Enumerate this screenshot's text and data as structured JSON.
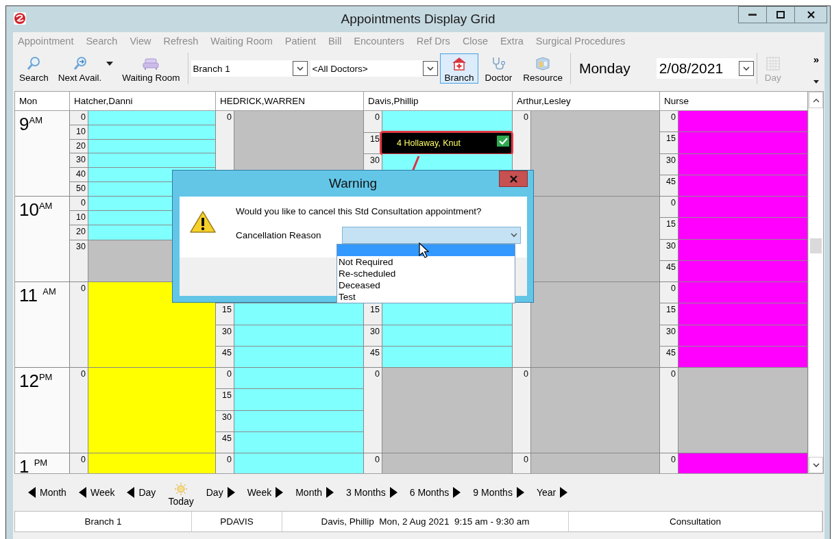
{
  "window": {
    "title": "Appointments Display Grid"
  },
  "menu": [
    {
      "label": "Appointment",
      "disabled": true
    },
    {
      "label": "Search",
      "disabled": true
    },
    {
      "label": "View",
      "disabled": true
    },
    {
      "label": "Refresh",
      "disabled": true
    },
    {
      "label": "Waiting Room",
      "disabled": true
    },
    {
      "label": "Patient",
      "disabled": true
    },
    {
      "label": "Bill",
      "disabled": true
    },
    {
      "label": "Encounters",
      "disabled": true
    },
    {
      "label": "Ref Drs",
      "disabled": true
    },
    {
      "label": "Close",
      "disabled": true
    },
    {
      "label": "Extra",
      "disabled": true
    },
    {
      "label": "Surgical Procedures",
      "disabled": true
    }
  ],
  "toolbar": {
    "tools": [
      {
        "label": "Search",
        "kind": "search"
      },
      {
        "label": "Next Avail.",
        "kind": "next",
        "has_menu": true
      },
      {
        "label": "Waiting Room",
        "kind": "sofa"
      }
    ],
    "branch_combo": "Branch 1",
    "doctor_combo": "<All Doctors>",
    "views": [
      {
        "label": "Branch",
        "kind": "branch",
        "selected": true
      },
      {
        "label": "Doctor",
        "kind": "doctor",
        "selected": false
      },
      {
        "label": "Resource",
        "kind": "resource",
        "selected": false
      }
    ],
    "weekday": "Monday",
    "date": "2/08/2021",
    "day_button": {
      "label": "Day",
      "disabled": true
    },
    "overflow": "»"
  },
  "grid": {
    "columns": [
      "Mon",
      "Hatcher,Danni",
      "HEDRICK,WARREN",
      "Davis,Phillip",
      "Arthur,Lesley",
      "Nurse"
    ],
    "hours": [
      {
        "time": "9$^{AM}$",
        "cells": [
          {
            "slots": [
              {
                "minute": "0",
                "color": "#80ffff"
              },
              {
                "minute": "10",
                "color": "#80ffff"
              },
              {
                "minute": "20",
                "color": "#80ffff"
              },
              {
                "minute": "30",
                "color": "#80ffff"
              },
              {
                "minute": "40",
                "color": "#80ffff"
              },
              {
                "minute": "50",
                "color": "#80ffff"
              }
            ]
          },
          {
            "slots": [
              {
                "minute": "0",
                "color": "#c0c0c0"
              }
            ]
          },
          {
            "slots": [
              {
                "minute": "0",
                "color": "#80ffff"
              },
              {
                "minute": "15",
                "appointment": {
                  "patient": "4 Hollaway, Knut",
                  "confirmed": true
                }
              },
              {
                "minute": "30",
                "color": "#80ffff"
              }
            ]
          },
          {
            "slots": [
              {
                "minute": "0",
                "color": "#c0c0c0"
              }
            ]
          },
          {
            "slots": [
              {
                "minute": "0",
                "color": "#ff00ff"
              },
              {
                "minute": "15",
                "color": "#ff00ff"
              },
              {
                "minute": "30",
                "color": "#ff00ff"
              },
              {
                "minute": "45",
                "color": "#ff00ff"
              }
            ]
          }
        ]
      },
      {
        "time": "10$^{AM}$",
        "cells": [
          {
            "slots": [
              {
                "minute": "0",
                "color": "#80ffff"
              },
              {
                "minute": "10",
                "color": "#80ffff"
              },
              {
                "minute": "20",
                "color": "#80ffff"
              },
              {
                "minute": "30",
                "color": "#c0c0c0"
              }
            ]
          },
          {},
          {},
          {
            "slots": [
              {
                "color": "#c0c0c0"
              }
            ]
          },
          {
            "slots": [
              {
                "minute": "0",
                "color": "#ff00ff"
              },
              {
                "minute": "15",
                "color": "#ff00ff"
              },
              {
                "minute": "30",
                "color": "#ff00ff"
              },
              {
                "minute": "45",
                "color": "#ff00ff"
              }
            ]
          }
        ]
      },
      {
        "time": "11 $^{AM}$",
        "cells": [
          {
            "slots": [
              {
                "minute": "0",
                "color": "#ffff00"
              }
            ]
          },
          {
            "slots": [
              {
                "minute": "15",
                "color": "#80ffff"
              },
              {
                "minute": "30",
                "color": "#80ffff"
              },
              {
                "minute": "45",
                "color": "#80ffff"
              }
            ]
          },
          {
            "slots": [
              {
                "minute": "15",
                "color": "#80ffff"
              },
              {
                "minute": "30",
                "color": "#80ffff"
              },
              {
                "minute": "45",
                "color": "#80ffff"
              }
            ]
          },
          {
            "slots": [
              {
                "color": "#c0c0c0"
              }
            ]
          },
          {
            "slots": [
              {
                "minute": "0",
                "color": "#ff00ff"
              },
              {
                "minute": "15",
                "color": "#ff00ff"
              },
              {
                "minute": "30",
                "color": "#ff00ff"
              },
              {
                "minute": "45",
                "color": "#ff00ff"
              }
            ]
          }
        ]
      },
      {
        "time": "12$^{PM}$",
        "cells": [
          {
            "slots": [
              {
                "minute": "0",
                "color": "#ffff00"
              }
            ]
          },
          {
            "slots": [
              {
                "minute": "0",
                "color": "#80ffff"
              },
              {
                "minute": "15",
                "color": "#80ffff"
              },
              {
                "minute": "30",
                "color": "#80ffff"
              },
              {
                "minute": "45",
                "color": "#80ffff"
              }
            ]
          },
          {
            "slots": [
              {
                "minute": "0",
                "color": "#c0c0c0"
              }
            ]
          },
          {
            "slots": [
              {
                "minute": "0",
                "color": "#c0c0c0"
              }
            ]
          },
          {
            "slots": [
              {
                "minute": "0",
                "color": "#c0c0c0"
              }
            ]
          }
        ]
      },
      {
        "time": "1 $^{PM}$",
        "cells": [
          {
            "slots": [
              {
                "minute": "0",
                "color": "#ffff00"
              }
            ]
          },
          {
            "slots": [
              {
                "minute": "0",
                "color": "#80ffff"
              }
            ]
          },
          {
            "slots": [
              {
                "minute": "0",
                "color": "#c0c0c0"
              }
            ]
          },
          {
            "slots": [
              {
                "minute": "0",
                "color": "#c0c0c0"
              }
            ]
          },
          {
            "slots": [
              {
                "minute": "0",
                "color": "#ff00ff"
              }
            ]
          }
        ]
      }
    ]
  },
  "dialog": {
    "title": "Warning",
    "message": "Would you like to cancel this Std Consultation appointment?",
    "field_label": "Cancellation Reason",
    "expanded": true,
    "options": [
      {
        "selected": true
      },
      {
        "label": "Not Required",
        "selected": false
      },
      {
        "label": "Re-scheduled",
        "selected": false
      },
      {
        "label": "Deceased",
        "selected": false
      },
      {
        "label": "Test",
        "selected": false
      }
    ]
  },
  "navigation": [
    {
      "label": "Month",
      "kind": "back"
    },
    {
      "label": "Week",
      "kind": "back"
    },
    {
      "label": "Day",
      "kind": "back"
    },
    {
      "label": "Today",
      "kind": "today"
    },
    {
      "label": "Day",
      "kind": "forward"
    },
    {
      "label": "Week",
      "kind": "forward"
    },
    {
      "label": "Month",
      "kind": "forward"
    },
    {
      "label": "3 Months",
      "kind": "forward"
    },
    {
      "label": "6 Months",
      "kind": "forward"
    },
    {
      "label": "9 Months",
      "kind": "forward"
    },
    {
      "label": "Year",
      "kind": "forward"
    }
  ],
  "status_bar": [
    "Branch 1",
    "PDAVIS",
    "Davis, Phillip  Mon, 2 Aug 2021  9:15 am - 9:30 am",
    "Consultation"
  ]
}
